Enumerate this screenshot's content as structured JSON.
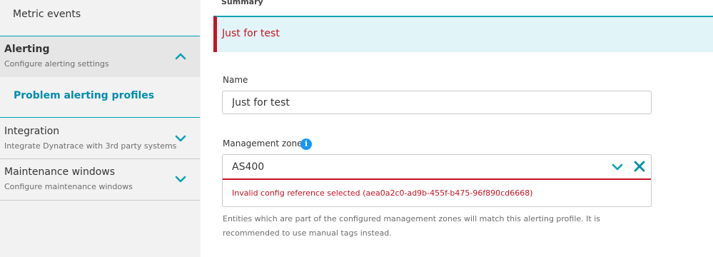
{
  "sidebar": {
    "metric_events": "Metric events",
    "alerting": {
      "title": "Alerting",
      "subtitle": "Configure alerting settings"
    },
    "problem_alerting_profiles": "Problem alerting profiles",
    "integration": {
      "title": "Integration",
      "subtitle": "Integrate Dynatrace with 3rd party systems"
    },
    "maintenance": {
      "title": "Maintenance windows",
      "subtitle": "Configure maintenance windows"
    }
  },
  "main": {
    "summary_label": "Summary",
    "banner_text": "Just for test",
    "name_label": "Name",
    "name_value": "Just for test",
    "zone_label": "Management zone",
    "zone_value": "AS400",
    "error_text": "Invalid config reference selected (aea0a2c0-ad9b-455f-b475-96f890cd6668)",
    "help_text": "Entities which are part of the configured management zones will match this alerting profile. It is recommended to use manual tags instead."
  },
  "icons": {
    "chevron_up": "chevron-up-icon",
    "chevron_down": "chevron-down-icon",
    "info": "info-icon",
    "close": "close-icon"
  },
  "colors": {
    "accent": "#00a1b2",
    "error": "#c41425",
    "info": "#1496ff",
    "sidebar_bg": "#f2f2f2",
    "active_bg": "#e6e6e6",
    "banner_bg": "#e1f5f8"
  }
}
